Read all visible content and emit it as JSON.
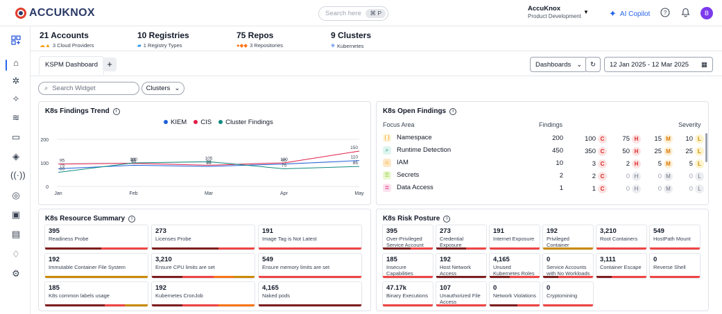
{
  "app": {
    "logo": "ACCUKNOX"
  },
  "search": {
    "placeholder": "Search here",
    "shortcut": "⌘ P"
  },
  "org": {
    "name": "AccuKnox",
    "sub": "Product Development"
  },
  "copilot": {
    "label": "AI Copilot"
  },
  "user": {
    "initial": "B"
  },
  "summary": [
    {
      "title": "21 Accounts",
      "sub": "3 Cloud Providers"
    },
    {
      "title": "10 Registries",
      "sub": "1 Registry Types"
    },
    {
      "title": "75 Repos",
      "sub": "3 Repositories"
    },
    {
      "title": "9 Clusters",
      "sub": "Kubernetes"
    }
  ],
  "tabs": {
    "active": "KSPM Dashboard",
    "add": "+"
  },
  "toolbar": {
    "dashboards": "Dashboards",
    "refresh": "↻",
    "date_range": "12 Jan 2025 - 12 Mar 2025"
  },
  "filters": {
    "search_placeholder": "Search Widget",
    "clusters": "Clusters"
  },
  "trend": {
    "title": "K8s Findings Trend",
    "legend": [
      {
        "name": "KIEM",
        "color": "#1d5fd8"
      },
      {
        "name": "CIS",
        "color": "#e11d48"
      },
      {
        "name": "Cluster Findings",
        "color": "#0f8a7e"
      }
    ]
  },
  "chart_data": {
    "type": "line",
    "categories": [
      "Jan",
      "Feb",
      "Mar",
      "Apr",
      "May"
    ],
    "ylim": [
      0,
      200
    ],
    "yticks": [
      0,
      100,
      200
    ],
    "series": [
      {
        "name": "KIEM",
        "color": "#1d5fd8",
        "values": [
          75,
          90,
          85,
          95,
          110
        ]
      },
      {
        "name": "CIS",
        "color": "#e11d48",
        "values": [
          95,
          98,
          90,
          100,
          150
        ]
      },
      {
        "name": "Cluster Findings",
        "color": "#0f8a7e",
        "values": [
          60,
          100,
          105,
          75,
          85
        ]
      }
    ]
  },
  "open_findings": {
    "title": "K8s Open Findings",
    "headers": {
      "area": "Focus Area",
      "findings": "Findings",
      "severity": "Severity"
    },
    "rows": [
      {
        "area": "Namespace",
        "findings": "200",
        "c": "100",
        "h": "75",
        "m": "15",
        "l": "10",
        "icon": "braces-icon",
        "color": "#f59e0b",
        "bg": "#fff5e0"
      },
      {
        "area": "Runtime Detection",
        "findings": "450",
        "c": "350",
        "h": "50",
        "m": "25",
        "l": "25",
        "icon": "search-shield-icon",
        "color": "#0f8a7e",
        "bg": "#dff5ef"
      },
      {
        "area": "IAM",
        "findings": "10",
        "c": "3",
        "h": "2",
        "m": "5",
        "l": "5",
        "icon": "user-group-icon",
        "color": "#f59e0b",
        "bg": "#fde8c8"
      },
      {
        "area": "Secrets",
        "findings": "2",
        "c": "2",
        "h": "0",
        "m": "0",
        "l": "0",
        "icon": "key-icon",
        "color": "#84cc16",
        "bg": "#eaf7d4"
      },
      {
        "area": "Data Access",
        "findings": "1",
        "c": "1",
        "h": "0",
        "m": "0",
        "l": "0",
        "icon": "database-icon",
        "color": "#db2777",
        "bg": "#fde2ee"
      }
    ]
  },
  "resource_summary": {
    "title": "K8s Resource Summary",
    "tiles": [
      {
        "value": "395",
        "label": "Readiness Probe",
        "bar": [
          [
            "#7f1d1d",
            0.55
          ],
          [
            "#ef4444",
            0.45
          ]
        ]
      },
      {
        "value": "273",
        "label": "Licenses Probe",
        "bar": [
          [
            "#7f1d1d",
            0.65
          ],
          [
            "#ef4444",
            0.35
          ]
        ]
      },
      {
        "value": "191",
        "label": "Image Tag is Not Latest",
        "bar": [
          [
            "#ef4444",
            1
          ]
        ]
      },
      {
        "value": "192",
        "label": "Immutable Container File System",
        "bar": [
          [
            "#ca8a04",
            1
          ]
        ]
      },
      {
        "value": "3,210",
        "label": "Ensure CPU limits are set",
        "bar": [
          [
            "#7f1d1d",
            0.3
          ],
          [
            "#ef4444",
            0.3
          ],
          [
            "#f97316",
            0.2
          ],
          [
            "#ca8a04",
            0.2
          ]
        ]
      },
      {
        "value": "549",
        "label": "Ensure memory limits are set",
        "bar": [
          [
            "#ef4444",
            1
          ]
        ]
      },
      {
        "value": "185",
        "label": "K8s common labels usage",
        "bar": [
          [
            "#7f1d1d",
            0.58
          ],
          [
            "#ef4444",
            0.2
          ],
          [
            "#ca8a04",
            0.22
          ]
        ]
      },
      {
        "value": "192",
        "label": "Kubernetes CronJob",
        "bar": [
          [
            "#7f1d1d",
            0.3
          ],
          [
            "#ef4444",
            0.35
          ],
          [
            "#f97316",
            0.35
          ]
        ]
      },
      {
        "value": "4,165",
        "label": "Naked pods",
        "bar": [
          [
            "#7f1d1d",
            1
          ]
        ]
      }
    ]
  },
  "risk_posture": {
    "title": "K8s Risk Posture",
    "tiles": [
      {
        "value": "395",
        "label": "Over-Privileged Service Account",
        "bar": [
          [
            "#7f1d1d",
            0.55
          ],
          [
            "#ef4444",
            0.45
          ]
        ]
      },
      {
        "value": "273",
        "label": "Credential Exposure",
        "bar": [
          [
            "#7f1d1d",
            0.6
          ],
          [
            "#ef4444",
            0.4
          ]
        ]
      },
      {
        "value": "191",
        "label": "Internet Exposure",
        "bar": [
          [
            "#ef4444",
            1
          ]
        ]
      },
      {
        "value": "192",
        "label": "Privileged Container",
        "bar": [
          [
            "#ca8a04",
            1
          ]
        ]
      },
      {
        "value": "3,210",
        "label": "Root Containers",
        "bar": [
          [
            "#ef4444",
            1
          ]
        ]
      },
      {
        "value": "549",
        "label": "HostPath Mount",
        "bar": [
          [
            "#ef4444",
            1
          ]
        ]
      },
      {
        "value": "185",
        "label": "Insecure Capabilities",
        "bar": [
          [
            "#ef4444",
            1
          ]
        ]
      },
      {
        "value": "192",
        "label": "Host Network Access",
        "bar": [
          [
            "#7f1d1d",
            1
          ]
        ]
      },
      {
        "value": "4,165",
        "label": "Unused Kubernetes Roles",
        "bar": [
          [
            "#7f1d1d",
            0.4
          ],
          [
            "#ef4444",
            0.6
          ]
        ]
      },
      {
        "value": "0",
        "label": "Service Accounts with No Workloads",
        "bar": [
          [
            "#7f1d1d",
            0.3
          ],
          [
            "#ef4444",
            0.7
          ]
        ]
      },
      {
        "value": "3,111",
        "label": "Container Escape",
        "bar": [
          [
            "#7f1d1d",
            0.3
          ],
          [
            "#ef4444",
            0.7
          ]
        ]
      },
      {
        "value": "0",
        "label": "Reverse Shell",
        "bar": [
          [
            "#ef4444",
            1
          ]
        ]
      },
      {
        "value": "47.17k",
        "label": "Binary Executions",
        "bar": [
          [
            "#ef4444",
            1
          ]
        ]
      },
      {
        "value": "107",
        "label": "Unauthorized File Access",
        "bar": [
          [
            "#ef4444",
            1
          ]
        ]
      },
      {
        "value": "0",
        "label": "Network Violations",
        "bar": [
          [
            "#7f1d1d",
            0.55
          ],
          [
            "#ef4444",
            0.45
          ]
        ]
      },
      {
        "value": "0",
        "label": "Cryptomining",
        "bar": [
          [
            "#ef4444",
            1
          ]
        ]
      }
    ]
  }
}
